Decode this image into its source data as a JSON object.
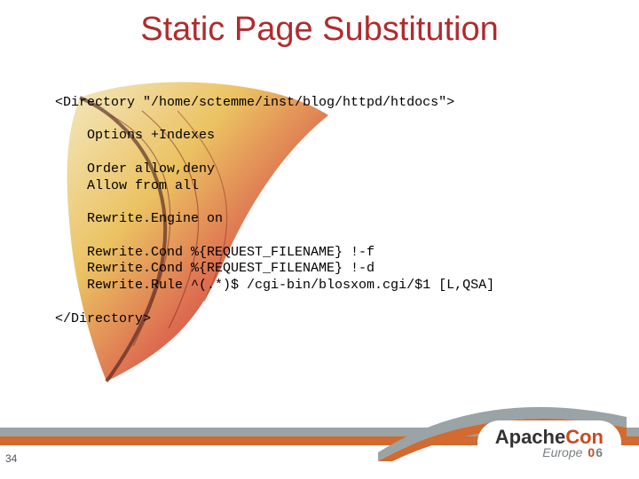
{
  "title": "Static Page Substitution",
  "code": {
    "l1": "<Directory \"/home/sctemme/inst/blog/httpd/htdocs\">",
    "l2": "    Options +Indexes",
    "l3": "    Order allow,deny",
    "l4": "    Allow from all",
    "l5": "    Rewrite.Engine on",
    "l6": "    Rewrite.Cond %{REQUEST_FILENAME} !-f",
    "l7": "    Rewrite.Cond %{REQUEST_FILENAME} !-d",
    "l8": "    Rewrite.Rule ^(.*)$ /cgi-bin/blosxom.cgi/$1 [L,QSA]",
    "l9": "</Directory>"
  },
  "page_number": "34",
  "logo": {
    "brand_a": "Apache",
    "brand_b": "Con",
    "sub": "Europe",
    "year_a": "0",
    "year_b": "6"
  }
}
